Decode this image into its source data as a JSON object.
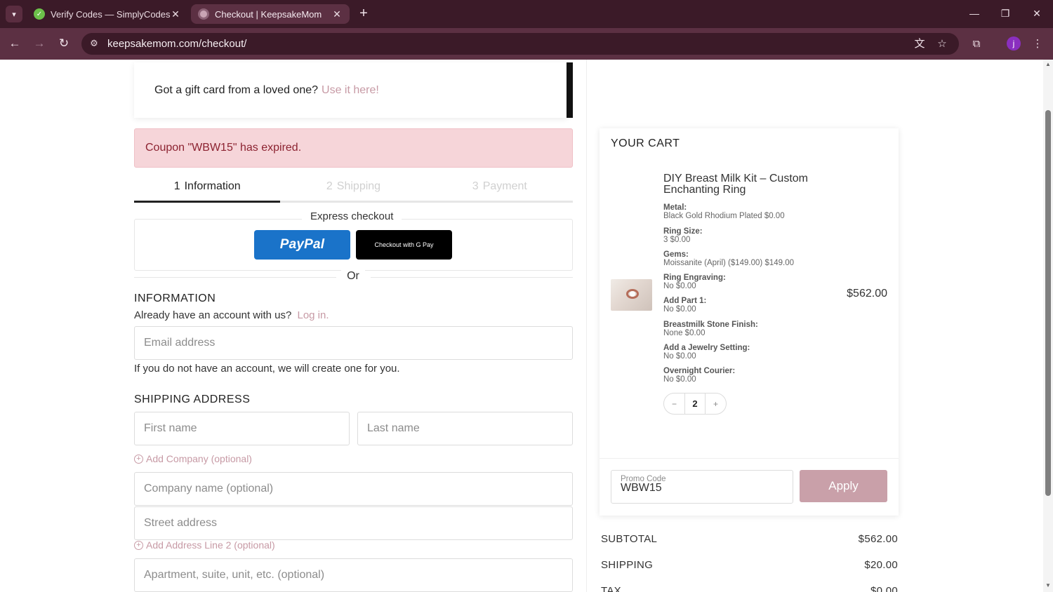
{
  "browser": {
    "tabs": [
      {
        "title": "Verify Codes — SimplyCodes",
        "active": false
      },
      {
        "title": "Checkout | KeepsakeMom",
        "active": true
      }
    ],
    "url": "keepsakemom.com/checkout/",
    "profile_initial": "j"
  },
  "giftcard": {
    "text": "Got a gift card from a loved one?",
    "link": "Use it here!"
  },
  "alert": "Coupon \"WBW15\" has expired.",
  "steps": [
    {
      "num": "1",
      "label": "Information",
      "active": true
    },
    {
      "num": "2",
      "label": "Shipping",
      "active": false
    },
    {
      "num": "3",
      "label": "Payment",
      "active": false
    }
  ],
  "express": {
    "label": "Express checkout",
    "paypal": "PayPal",
    "gpay": "Checkout with G Pay",
    "or": "Or"
  },
  "information": {
    "title": "INFORMATION",
    "account_text": "Already have an account with us?",
    "login_link": "Log in.",
    "email_placeholder": "Email address",
    "note": "If you do not have an account, we will create one for you."
  },
  "shipping_address": {
    "title": "SHIPPING ADDRESS",
    "first_name": "First name",
    "last_name": "Last name",
    "add_company": "Add Company (optional)",
    "company": "Company name (optional)",
    "street": "Street address",
    "add_line2": "Add Address Line 2 (optional)",
    "apartment": "Apartment, suite, unit, etc. (optional)"
  },
  "cart": {
    "title": "YOUR CART",
    "product_name": "DIY Breast Milk Kit – Custom Enchanting Ring",
    "options": [
      {
        "label": "Metal:",
        "value": "Black Gold Rhodium Plated $0.00"
      },
      {
        "label": "Ring Size:",
        "value": "3 $0.00"
      },
      {
        "label": "Gems:",
        "value": "Moissanite (April) ($149.00) $149.00"
      },
      {
        "label": "Ring Engraving:",
        "value": "No $0.00"
      },
      {
        "label": "Add Part 1:",
        "value": "No $0.00"
      },
      {
        "label": "Breastmilk Stone Finish:",
        "value": "None $0.00"
      },
      {
        "label": "Add a Jewelry Setting:",
        "value": "No $0.00"
      },
      {
        "label": "Overnight Courier:",
        "value": "No $0.00"
      }
    ],
    "price": "$562.00",
    "quantity": "2",
    "qty_minus": "−",
    "qty_plus": "+",
    "promo_label": "Promo Code",
    "promo_value": "WBW15",
    "apply": "Apply"
  },
  "totals": [
    {
      "label": "SUBTOTAL",
      "value": "$562.00"
    },
    {
      "label": "SHIPPING",
      "value": "$20.00"
    },
    {
      "label": "TAX",
      "value": "$0.00"
    }
  ],
  "colors": {
    "chrome_dark": "#3b1a28",
    "chrome_toolbar": "#5c3043",
    "accent_link": "#c79aa5",
    "alert_bg": "#f6d5d9",
    "apply_bg": "#c9a0a9",
    "paypal_blue": "#1a73c9"
  }
}
